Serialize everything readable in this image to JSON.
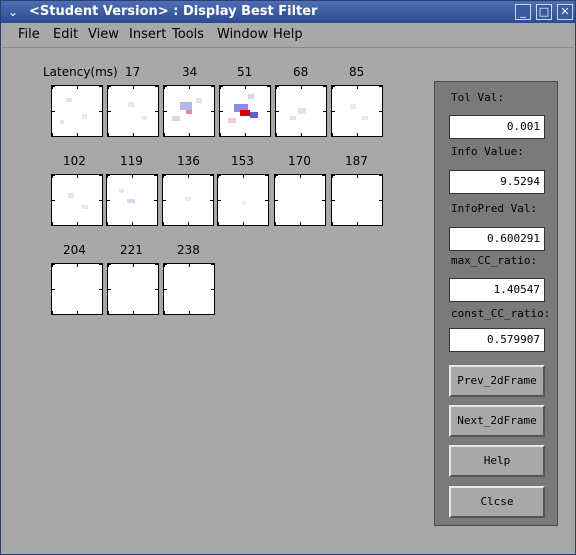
{
  "window": {
    "title": "<Student Version> : Display Best Filter",
    "menu": [
      {
        "label": "File"
      },
      {
        "label": "Edit"
      },
      {
        "label": "View"
      },
      {
        "label": "Insert"
      },
      {
        "label": "Tools"
      },
      {
        "label": "Window"
      },
      {
        "label": "Help"
      }
    ]
  },
  "grid": {
    "header_label": "Latency(ms)",
    "latencies": [
      "17",
      "34",
      "51",
      "68",
      "85",
      "102",
      "119",
      "136",
      "153",
      "170",
      "187",
      "204",
      "221",
      "238"
    ]
  },
  "panel": {
    "tol_label": "Tol Val:",
    "tol_value": "0.001",
    "info_label": "Info Value:",
    "info_value": "9.5294",
    "infopred_label": "InfoPred Val:",
    "infopred_value": "0.600291",
    "maxcc_label": "max_CC_ratio:",
    "maxcc_value": "1.40547",
    "constcc_label": "const_CC_ratio:",
    "constcc_value": "0.579907",
    "prev_label": "Prev_2dFrame",
    "next_label": "Next_2dFrame",
    "help_label": "Help",
    "close_label": "Clcse"
  },
  "colors": {
    "titlebar": "#3a5aa0",
    "background": "#a8a8a8",
    "panel": "#7a7a7a",
    "positive": "#d40000",
    "negative": "#2c3fd0"
  }
}
